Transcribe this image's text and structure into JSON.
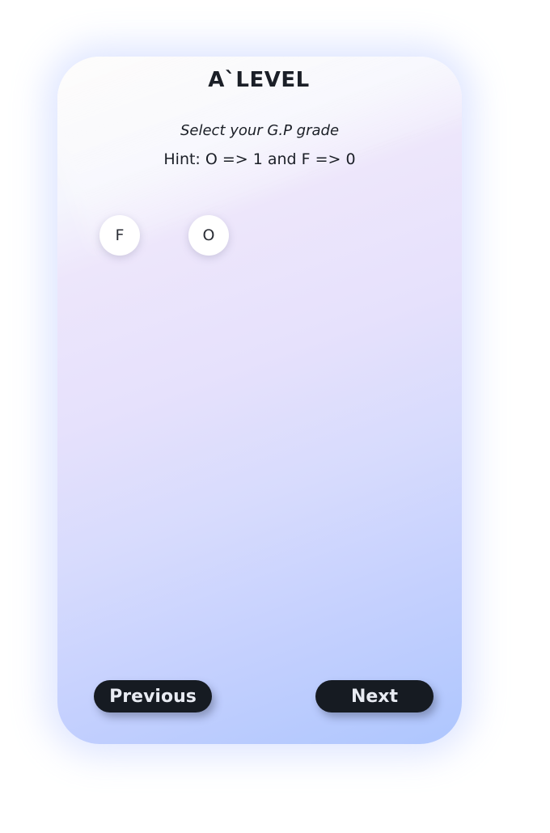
{
  "header": {
    "title": "A`LEVEL"
  },
  "prompt": {
    "subtitle": "Select your G.P grade",
    "hint": "Hint:  O => 1 and F => 0"
  },
  "grades": [
    {
      "label": "F"
    },
    {
      "label": "O"
    }
  ],
  "navigation": {
    "previous_label": "Previous",
    "next_label": "Next"
  },
  "colors": {
    "button_dark": "#161b22",
    "text_dark": "#1b1f27",
    "gradient_end": "#aec6fe"
  }
}
